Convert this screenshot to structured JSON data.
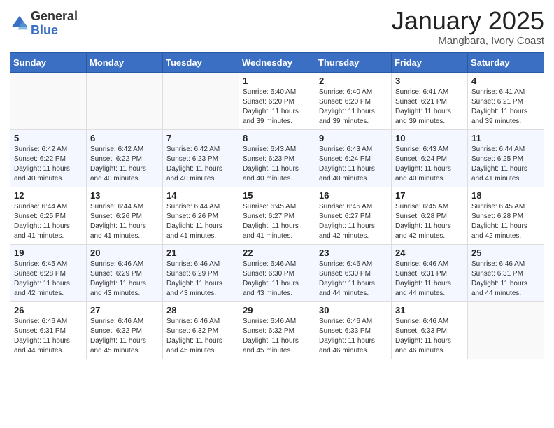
{
  "header": {
    "logo_general": "General",
    "logo_blue": "Blue",
    "month_title": "January 2025",
    "location": "Mangbara, Ivory Coast"
  },
  "days_of_week": [
    "Sunday",
    "Monday",
    "Tuesday",
    "Wednesday",
    "Thursday",
    "Friday",
    "Saturday"
  ],
  "weeks": [
    [
      {
        "day": "",
        "info": ""
      },
      {
        "day": "",
        "info": ""
      },
      {
        "day": "",
        "info": ""
      },
      {
        "day": "1",
        "info": "Sunrise: 6:40 AM\nSunset: 6:20 PM\nDaylight: 11 hours and 39 minutes."
      },
      {
        "day": "2",
        "info": "Sunrise: 6:40 AM\nSunset: 6:20 PM\nDaylight: 11 hours and 39 minutes."
      },
      {
        "day": "3",
        "info": "Sunrise: 6:41 AM\nSunset: 6:21 PM\nDaylight: 11 hours and 39 minutes."
      },
      {
        "day": "4",
        "info": "Sunrise: 6:41 AM\nSunset: 6:21 PM\nDaylight: 11 hours and 39 minutes."
      }
    ],
    [
      {
        "day": "5",
        "info": "Sunrise: 6:42 AM\nSunset: 6:22 PM\nDaylight: 11 hours and 40 minutes."
      },
      {
        "day": "6",
        "info": "Sunrise: 6:42 AM\nSunset: 6:22 PM\nDaylight: 11 hours and 40 minutes."
      },
      {
        "day": "7",
        "info": "Sunrise: 6:42 AM\nSunset: 6:23 PM\nDaylight: 11 hours and 40 minutes."
      },
      {
        "day": "8",
        "info": "Sunrise: 6:43 AM\nSunset: 6:23 PM\nDaylight: 11 hours and 40 minutes."
      },
      {
        "day": "9",
        "info": "Sunrise: 6:43 AM\nSunset: 6:24 PM\nDaylight: 11 hours and 40 minutes."
      },
      {
        "day": "10",
        "info": "Sunrise: 6:43 AM\nSunset: 6:24 PM\nDaylight: 11 hours and 40 minutes."
      },
      {
        "day": "11",
        "info": "Sunrise: 6:44 AM\nSunset: 6:25 PM\nDaylight: 11 hours and 41 minutes."
      }
    ],
    [
      {
        "day": "12",
        "info": "Sunrise: 6:44 AM\nSunset: 6:25 PM\nDaylight: 11 hours and 41 minutes."
      },
      {
        "day": "13",
        "info": "Sunrise: 6:44 AM\nSunset: 6:26 PM\nDaylight: 11 hours and 41 minutes."
      },
      {
        "day": "14",
        "info": "Sunrise: 6:44 AM\nSunset: 6:26 PM\nDaylight: 11 hours and 41 minutes."
      },
      {
        "day": "15",
        "info": "Sunrise: 6:45 AM\nSunset: 6:27 PM\nDaylight: 11 hours and 41 minutes."
      },
      {
        "day": "16",
        "info": "Sunrise: 6:45 AM\nSunset: 6:27 PM\nDaylight: 11 hours and 42 minutes."
      },
      {
        "day": "17",
        "info": "Sunrise: 6:45 AM\nSunset: 6:28 PM\nDaylight: 11 hours and 42 minutes."
      },
      {
        "day": "18",
        "info": "Sunrise: 6:45 AM\nSunset: 6:28 PM\nDaylight: 11 hours and 42 minutes."
      }
    ],
    [
      {
        "day": "19",
        "info": "Sunrise: 6:45 AM\nSunset: 6:28 PM\nDaylight: 11 hours and 42 minutes."
      },
      {
        "day": "20",
        "info": "Sunrise: 6:46 AM\nSunset: 6:29 PM\nDaylight: 11 hours and 43 minutes."
      },
      {
        "day": "21",
        "info": "Sunrise: 6:46 AM\nSunset: 6:29 PM\nDaylight: 11 hours and 43 minutes."
      },
      {
        "day": "22",
        "info": "Sunrise: 6:46 AM\nSunset: 6:30 PM\nDaylight: 11 hours and 43 minutes."
      },
      {
        "day": "23",
        "info": "Sunrise: 6:46 AM\nSunset: 6:30 PM\nDaylight: 11 hours and 44 minutes."
      },
      {
        "day": "24",
        "info": "Sunrise: 6:46 AM\nSunset: 6:31 PM\nDaylight: 11 hours and 44 minutes."
      },
      {
        "day": "25",
        "info": "Sunrise: 6:46 AM\nSunset: 6:31 PM\nDaylight: 11 hours and 44 minutes."
      }
    ],
    [
      {
        "day": "26",
        "info": "Sunrise: 6:46 AM\nSunset: 6:31 PM\nDaylight: 11 hours and 44 minutes."
      },
      {
        "day": "27",
        "info": "Sunrise: 6:46 AM\nSunset: 6:32 PM\nDaylight: 11 hours and 45 minutes."
      },
      {
        "day": "28",
        "info": "Sunrise: 6:46 AM\nSunset: 6:32 PM\nDaylight: 11 hours and 45 minutes."
      },
      {
        "day": "29",
        "info": "Sunrise: 6:46 AM\nSunset: 6:32 PM\nDaylight: 11 hours and 45 minutes."
      },
      {
        "day": "30",
        "info": "Sunrise: 6:46 AM\nSunset: 6:33 PM\nDaylight: 11 hours and 46 minutes."
      },
      {
        "day": "31",
        "info": "Sunrise: 6:46 AM\nSunset: 6:33 PM\nDaylight: 11 hours and 46 minutes."
      },
      {
        "day": "",
        "info": ""
      }
    ]
  ]
}
